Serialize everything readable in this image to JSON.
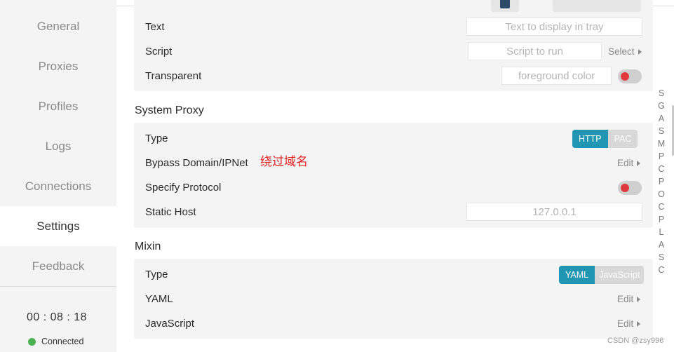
{
  "sidebar": {
    "items": [
      {
        "label": "General"
      },
      {
        "label": "Proxies"
      },
      {
        "label": "Profiles"
      },
      {
        "label": "Logs"
      },
      {
        "label": "Connections"
      },
      {
        "label": "Settings"
      },
      {
        "label": "Feedback"
      }
    ],
    "active_index": 5,
    "timer": "00 : 08 : 18",
    "status": "Connected",
    "status_color": "#4caf50"
  },
  "tray": {
    "text_label": "Text",
    "text_placeholder": "Text to display in tray",
    "script_label": "Script",
    "script_placeholder": "Script to run",
    "script_select": "Select",
    "transparent_label": "Transparent",
    "transparent_placeholder": "foreground color"
  },
  "system_proxy": {
    "title": "System Proxy",
    "type_label": "Type",
    "type_options": [
      "HTTP",
      "PAC"
    ],
    "type_selected": "HTTP",
    "bypass_label": "Bypass Domain/IPNet",
    "bypass_annotation": "绕过域名",
    "bypass_action": "Edit",
    "protocol_label": "Specify Protocol",
    "static_host_label": "Static Host",
    "static_host_placeholder": "127.0.0.1"
  },
  "mixin": {
    "title": "Mixin",
    "type_label": "Type",
    "type_options": [
      "YAML",
      "JavaScript"
    ],
    "type_selected": "YAML",
    "yaml_label": "YAML",
    "yaml_action": "Edit",
    "js_label": "JavaScript",
    "js_action": "Edit"
  },
  "letter_index": [
    "S",
    "G",
    "A",
    "S",
    "M",
    "P",
    "C",
    "P",
    "O",
    "C",
    "P",
    "L",
    "A",
    "S",
    "C"
  ],
  "watermark": "CSDN @zsy996",
  "colors": {
    "accent": "#2196b3",
    "toggle_off_knob": "#e0383e",
    "annotation": "#e02020"
  }
}
